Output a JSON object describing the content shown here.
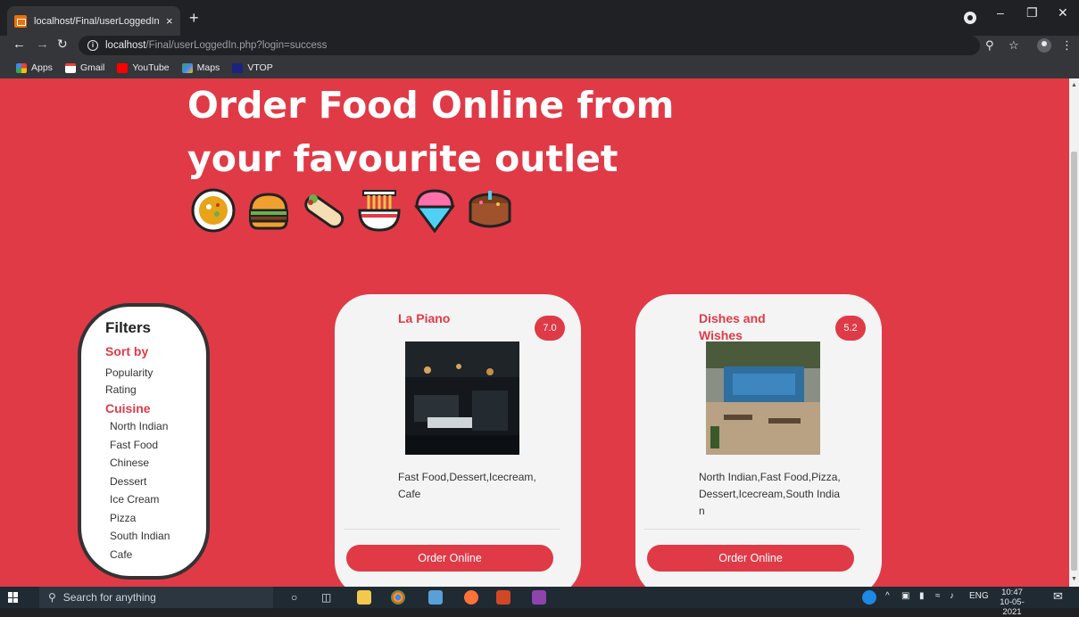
{
  "browser": {
    "tab_title": "localhost/Final/userLoggedIn.php",
    "url_host": "localhost",
    "url_path": "/Final/userLoggedIn.php?login=success",
    "new_tab": "+",
    "tab_close": "×",
    "bookmarks": [
      {
        "label": "Apps",
        "icon": "apps-grid-icon",
        "color": "#ea4335"
      },
      {
        "label": "Gmail",
        "icon": "gmail-icon",
        "color": "#ea4335"
      },
      {
        "label": "YouTube",
        "icon": "youtube-icon",
        "color": "#ff0000"
      },
      {
        "label": "Maps",
        "icon": "maps-icon",
        "color": "#34a853"
      },
      {
        "label": "VTOP",
        "icon": "vtop-icon",
        "color": "#1a237e"
      }
    ]
  },
  "hero": {
    "line1": "Order Food Online from",
    "line2": "your favourite outlet",
    "emojis": [
      "curry-rice-icon",
      "burger-icon",
      "burrito-icon",
      "noodles-icon",
      "shaved-ice-icon",
      "cake-icon"
    ]
  },
  "filters": {
    "title": "Filters",
    "sort_heading": "Sort by",
    "sort_options": [
      "Popularity",
      "Rating"
    ],
    "cuisine_heading": "Cuisine",
    "cuisines": [
      "North Indian",
      "Fast Food",
      "Chinese",
      "Dessert",
      "Ice Cream",
      "Pizza",
      "South Indian",
      "Cafe"
    ]
  },
  "restaurants": [
    {
      "name": "La Piano",
      "rating": "7.0",
      "cuisines": "Fast Food,Dessert,Icecream,Cafe",
      "button": "Order Online"
    },
    {
      "name": "Dishes and Wishes",
      "rating": "5.2",
      "cuisines": "North Indian,Fast Food,Pizza,Dessert,Icecream,South Indian",
      "button": "Order Online"
    }
  ],
  "taskbar": {
    "search_placeholder": "Search for anything",
    "language": "ENG",
    "time": "10:47",
    "date": "10-05-2021"
  },
  "colors": {
    "brand_red": "#e03a47",
    "card_bg": "#f4f4f4"
  }
}
